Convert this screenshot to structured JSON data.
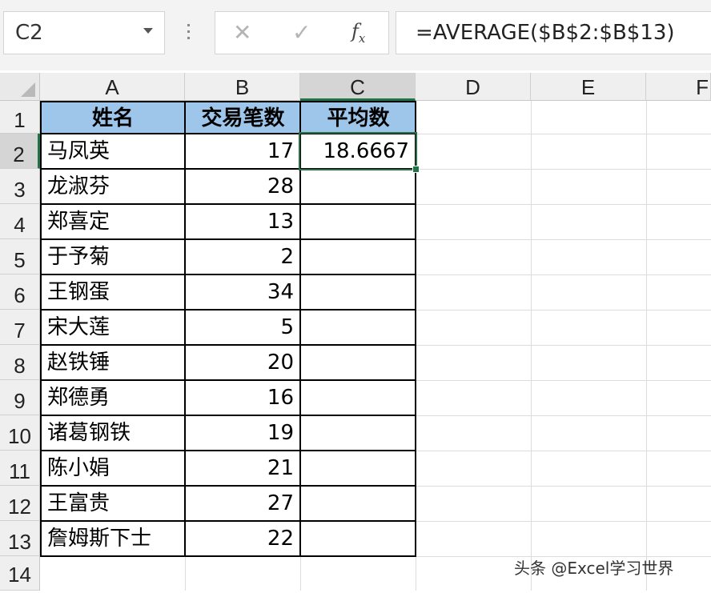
{
  "name_box": "C2",
  "formula_bar": {
    "cancel_icon": "✕",
    "enter_icon": "✓",
    "fx_icon": "fx",
    "formula": "=AVERAGE($B$2:$B$13)"
  },
  "columns": [
    "A",
    "B",
    "C",
    "D",
    "E",
    "F"
  ],
  "selected_column": "C",
  "row_numbers": [
    "1",
    "2",
    "3",
    "4",
    "5",
    "6",
    "7",
    "8",
    "9",
    "10",
    "11",
    "12",
    "13",
    "14"
  ],
  "selected_row": "2",
  "headers": {
    "A": "姓名",
    "B": "交易笔数",
    "C": "平均数"
  },
  "rows": [
    {
      "name": "马凤英",
      "count": "17"
    },
    {
      "name": "龙淑芬",
      "count": "28"
    },
    {
      "name": "郑喜定",
      "count": "13"
    },
    {
      "name": "于予菊",
      "count": "2"
    },
    {
      "name": "王钢蛋",
      "count": "34"
    },
    {
      "name": "宋大莲",
      "count": "5"
    },
    {
      "name": "赵铁锤",
      "count": "20"
    },
    {
      "name": "郑德勇",
      "count": "16"
    },
    {
      "name": "诸葛钢铁",
      "count": "19"
    },
    {
      "name": "陈小娟",
      "count": "21"
    },
    {
      "name": "王富贵",
      "count": "27"
    },
    {
      "name": "詹姆斯下士",
      "count": "22"
    }
  ],
  "average_value": "18.6667",
  "watermark": "头条 @Excel学习世界",
  "colors": {
    "header_fill": "#9ec6ea",
    "selection": "#217346"
  }
}
